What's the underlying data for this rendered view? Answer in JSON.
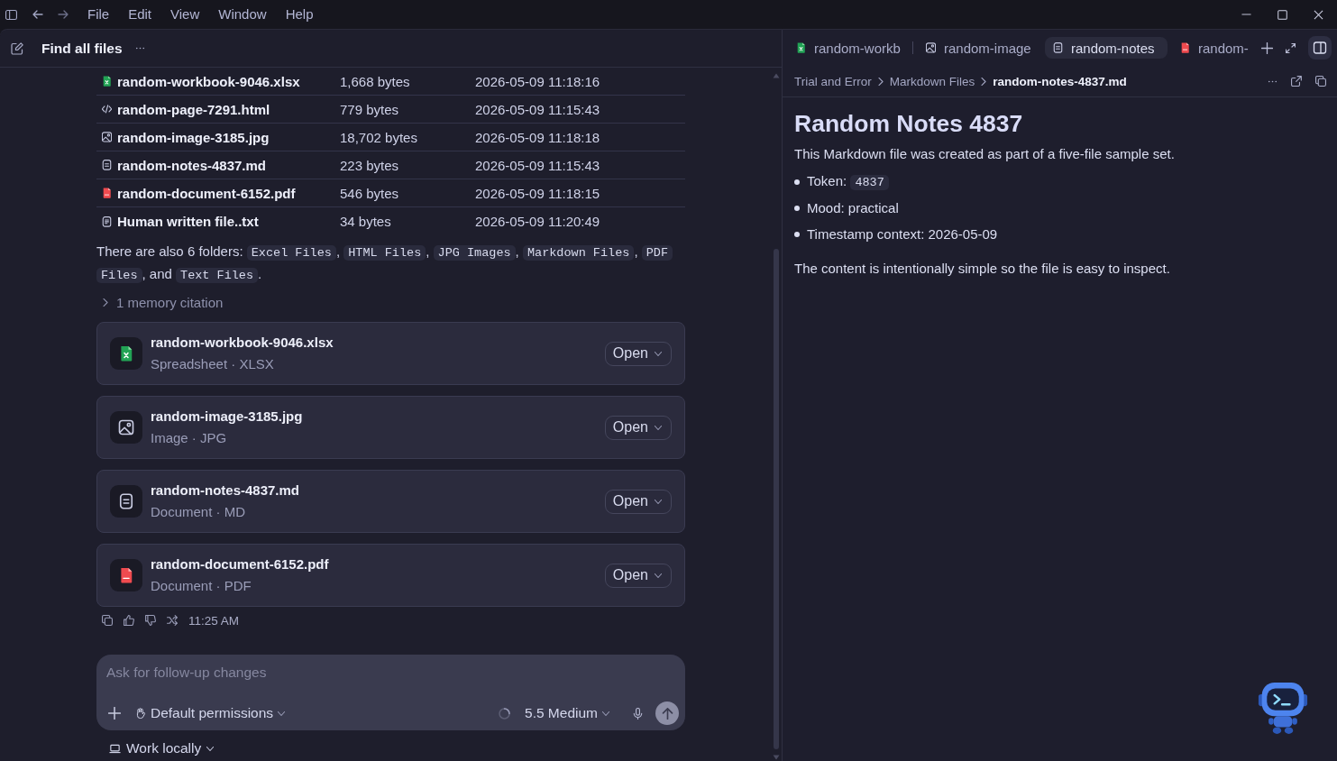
{
  "title_bar": {
    "menu": [
      "File",
      "Edit",
      "View",
      "Window",
      "Help"
    ]
  },
  "thread": {
    "title": "Find all files",
    "files": [
      {
        "kind": "xlsx",
        "name": "random-workbook-9046.xlsx",
        "size": "1,668 bytes",
        "modified": "2026-05-09 11:18:16"
      },
      {
        "kind": "html",
        "name": "random-page-7291.html",
        "size": "779 bytes",
        "modified": "2026-05-09 11:15:43"
      },
      {
        "kind": "image",
        "name": "random-image-3185.jpg",
        "size": "18,702 bytes",
        "modified": "2026-05-09 11:18:18"
      },
      {
        "kind": "markdown",
        "name": "random-notes-4837.md",
        "size": "223 bytes",
        "modified": "2026-05-09 11:15:43"
      },
      {
        "kind": "pdf",
        "name": "random-document-6152.pdf",
        "size": "546 bytes",
        "modified": "2026-05-09 11:18:15"
      },
      {
        "kind": "text",
        "name": "Human written file..txt",
        "size": "34 bytes",
        "modified": "2026-05-09 11:20:49"
      }
    ],
    "folders_note": [
      {
        "kind": "text",
        "text": "There are also 6 folders: "
      },
      {
        "kind": "code",
        "text": "Excel Files"
      },
      {
        "kind": "text",
        "text": ", "
      },
      {
        "kind": "code",
        "text": "HTML Files"
      },
      {
        "kind": "text",
        "text": ", "
      },
      {
        "kind": "code",
        "text": "JPG Images"
      },
      {
        "kind": "text",
        "text": ", "
      },
      {
        "kind": "code",
        "text": "Markdown Files"
      },
      {
        "kind": "text",
        "text": ", "
      },
      {
        "kind": "code",
        "text": "PDF Files"
      },
      {
        "kind": "text",
        "text": ", and "
      },
      {
        "kind": "code",
        "text": "Text Files"
      },
      {
        "kind": "text",
        "text": "."
      }
    ],
    "memory_citation": {
      "label": "1 memory citation",
      "expanded": false
    },
    "attachments": [
      {
        "kind": "xlsx",
        "name": "random-workbook-9046.xlsx",
        "type": "Spreadsheet · XLSX",
        "action": "Open"
      },
      {
        "kind": "image",
        "name": "random-image-3185.jpg",
        "type": "Image · JPG",
        "action": "Open"
      },
      {
        "kind": "markdown",
        "name": "random-notes-4837.md",
        "type": "Document · MD",
        "action": "Open"
      },
      {
        "kind": "pdf",
        "name": "random-document-6152.pdf",
        "type": "Document · PDF",
        "action": "Open"
      }
    ],
    "message_time": "11:25 AM",
    "composer": {
      "placeholder": "Ask for follow-up changes",
      "permissions": "Default permissions",
      "model": "5.5 Medium"
    },
    "workspace": "Work locally"
  },
  "editor": {
    "tabs": [
      {
        "kind": "xlsx",
        "label": "random-workb",
        "selected": false
      },
      {
        "kind": "image",
        "label": "random-image",
        "selected": false
      },
      {
        "kind": "markdown",
        "label": "random-notes",
        "selected": true
      },
      {
        "kind": "pdf",
        "label": "random-",
        "selected": false
      }
    ],
    "breadcrumb": [
      "Trial and Error",
      "Markdown Files",
      "random-notes-4837.md"
    ],
    "document": {
      "title": "Random Notes 4837",
      "intro": "This Markdown file was created as part of a five-file sample set.",
      "bullets": [
        {
          "segments": [
            {
              "kind": "text",
              "text": "Token: "
            },
            {
              "kind": "code",
              "text": "4837"
            }
          ]
        },
        {
          "segments": [
            {
              "kind": "text",
              "text": "Mood: practical"
            }
          ]
        },
        {
          "segments": [
            {
              "kind": "text",
              "text": "Timestamp context: 2026-05-09"
            }
          ]
        }
      ],
      "closing": "The content is intentionally simple so the file is easy to inspect."
    }
  }
}
